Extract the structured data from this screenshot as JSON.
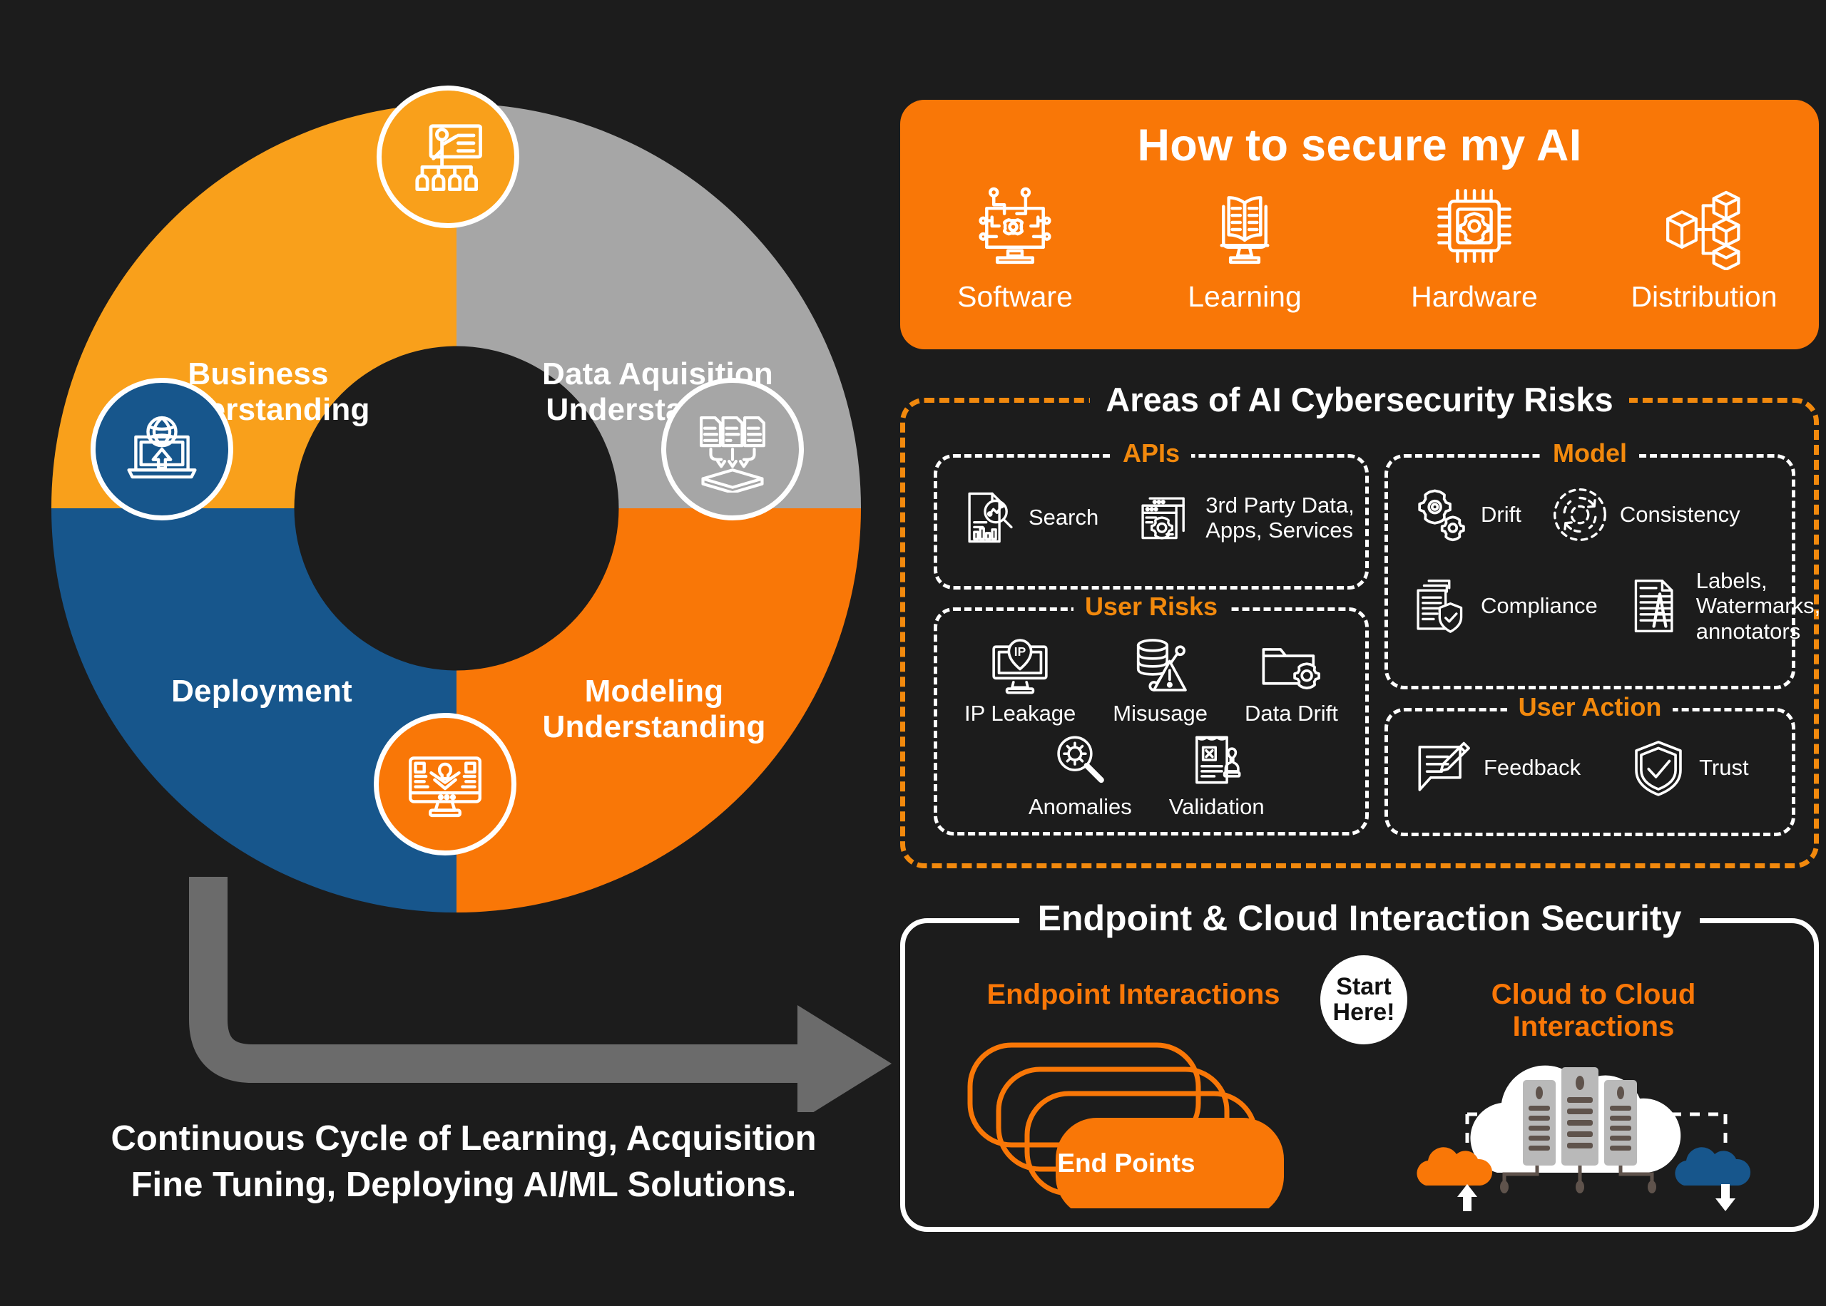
{
  "theme": {
    "background": "#1c1c1c",
    "orange": "#f97707",
    "amber": "#f9a01b",
    "blue": "#17568c",
    "gray": "#a6a6a6",
    "arrow_gray": "#6b6b6b",
    "white": "#ffffff"
  },
  "lifecycle": {
    "quadrants": [
      {
        "label": "Business\nUnderstanding",
        "line1": "Business",
        "line2": "Understanding",
        "color": "#f9a01b",
        "icon": "presentation-training-icon"
      },
      {
        "label": "Data Aquisition\nUnderstanding",
        "line1": "Data Aquisition",
        "line2": "Understanding",
        "color": "#a6a6a6",
        "icon": "documents-to-storage-icon"
      },
      {
        "label": "Modeling\nUnderstanding",
        "line1": "Modeling",
        "line2": "Understanding",
        "color": "#f97707",
        "icon": "monitor-ai-model-icon"
      },
      {
        "label": "Deployment",
        "line1": "Deployment",
        "line2": "",
        "color": "#17568c",
        "icon": "laptop-globe-upload-icon"
      }
    ],
    "caption_line1": "Continuous Cycle of Learning, Acquisition",
    "caption_line2": "Fine Tuning, Deploying AI/ML Solutions."
  },
  "secure_banner": {
    "title": "How to secure my AI",
    "items": [
      {
        "label": "Software",
        "icon": "monitor-circuit-gear-icon"
      },
      {
        "label": "Learning",
        "icon": "open-book-monitor-icon"
      },
      {
        "label": "Hardware",
        "icon": "cpu-chip-gear-icon"
      },
      {
        "label": "Distribution",
        "icon": "cube-distribution-icon"
      }
    ]
  },
  "risk_areas": {
    "title": "Areas of AI Cybersecurity  Risks",
    "groups": [
      {
        "title": "APIs",
        "items": [
          {
            "label": "Search",
            "icon": "report-magnifier-icon"
          },
          {
            "label": "3rd Party Data,\nApps, Services",
            "line1": "3rd Party Data,",
            "line2": "Apps, Services",
            "icon": "browser-windows-gear-icon"
          }
        ]
      },
      {
        "title": "User Risks",
        "items": [
          {
            "label": "IP Leakage",
            "icon": "monitor-ip-pin-icon"
          },
          {
            "label": "Misusage",
            "icon": "database-warning-icon"
          },
          {
            "label": "Data Drift",
            "icon": "folder-gear-icon"
          },
          {
            "label": "Anomalies",
            "icon": "magnifier-virus-icon"
          },
          {
            "label": "Validation",
            "icon": "document-stamp-x-icon"
          }
        ]
      },
      {
        "title": "Model",
        "items": [
          {
            "label": "Drift",
            "icon": "two-gears-icon"
          },
          {
            "label": "Consistency",
            "icon": "dashed-refresh-cycle-icon"
          },
          {
            "label": "Compliance",
            "icon": "documents-shield-check-icon"
          },
          {
            "label": "Labels,\nWatermarks,\nannotators",
            "line1": "Labels,",
            "line2": "Watermarks,",
            "line3": "annotators",
            "icon": "document-watermark-a-icon"
          }
        ]
      },
      {
        "title": "User Action",
        "items": [
          {
            "label": "Feedback",
            "icon": "speech-bubble-pencil-icon"
          },
          {
            "label": "Trust",
            "icon": "shield-check-icon"
          }
        ]
      }
    ]
  },
  "endpoint_cloud": {
    "title": "Endpoint & Cloud Interaction Security",
    "left_heading": "Endpoint Interactions",
    "right_heading": "Cloud to Cloud Interactions",
    "start_badge_line1": "Start",
    "start_badge_line2": "Here!",
    "endpoints_label": "End Points",
    "cloud_icon": "cloud-servers-icon",
    "upload_icon": "cloud-upload-arrow-icon",
    "download_icon": "cloud-download-arrow-icon"
  }
}
